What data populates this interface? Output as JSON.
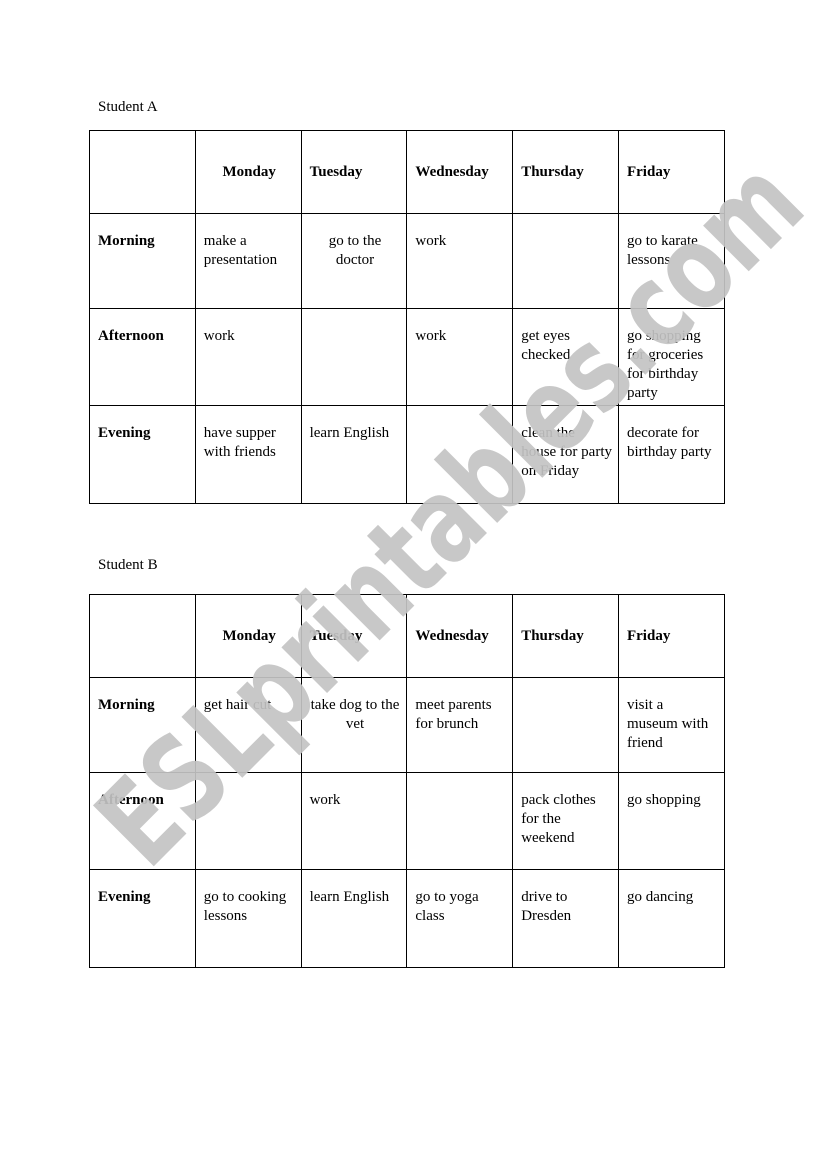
{
  "student_a": {
    "label": "Student A",
    "days": [
      "Monday",
      "Tuesday",
      "Wednesday",
      "Thursday",
      "Friday"
    ],
    "rows": [
      {
        "period": "Morning",
        "cells": [
          "make a presentation",
          "go to the doctor",
          "work",
          "",
          "go to karate lessons"
        ]
      },
      {
        "period": "Afternoon",
        "cells": [
          "work",
          "",
          "work",
          "get eyes checked",
          "go shopping for groceries for birthday party"
        ]
      },
      {
        "period": "Evening",
        "cells": [
          "have supper with friends",
          "learn English",
          "",
          "clean the house for party on Friday",
          "decorate for birthday party"
        ]
      }
    ]
  },
  "student_b": {
    "label": "Student B",
    "days": [
      "Monday",
      "Tuesday",
      "Wednesday",
      "Thursday",
      "Friday"
    ],
    "rows": [
      {
        "period": "Morning",
        "cells": [
          "get hair cut",
          "take dog to the vet",
          "meet parents for brunch",
          "",
          "visit a museum with friend"
        ]
      },
      {
        "period": "Afternoon",
        "cells": [
          "",
          "work",
          "",
          "pack clothes for the weekend",
          "go shopping"
        ]
      },
      {
        "period": "Evening",
        "cells": [
          "go to cooking lessons",
          "learn English",
          "go to yoga class",
          "drive to Dresden",
          "go dancing"
        ]
      }
    ]
  },
  "watermark": {
    "text": "ESLprintables.com",
    "color": "#c4c4c4"
  }
}
